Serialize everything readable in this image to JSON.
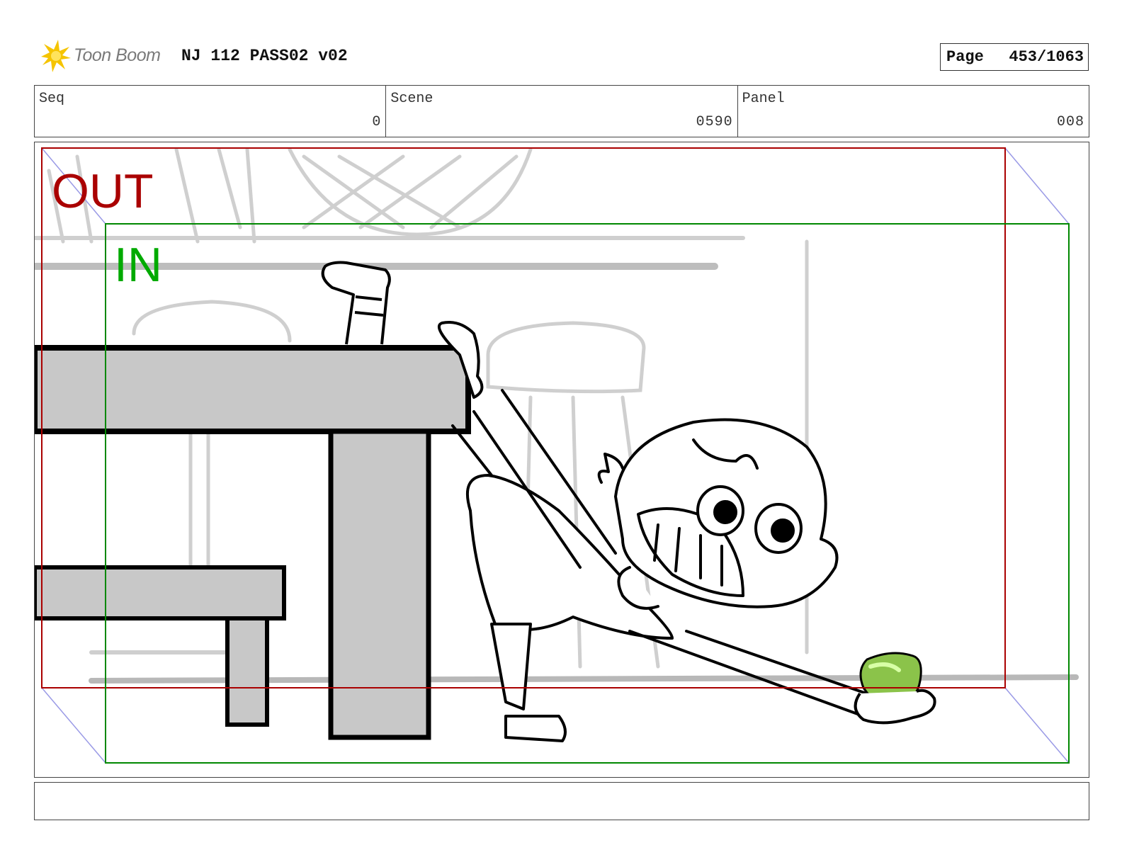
{
  "header": {
    "logo_text": "Toon Boom",
    "title": "NJ 112 PASS02 v02",
    "page_label": "Page",
    "page_value": "453/1063"
  },
  "info": {
    "seq_label": "Seq",
    "seq_value": "0",
    "scene_label": "Scene",
    "scene_value": "0590",
    "panel_label": "Panel",
    "panel_value": "008"
  },
  "frame": {
    "out_label": "OUT",
    "in_label": "IN",
    "out_color": "#aa0000",
    "in_color": "#008800"
  },
  "colors": {
    "table_gray": "#c8c8c8",
    "apple_green": "#8bc34a",
    "logo_yellow": "#f5c400"
  },
  "notes": {
    "text": ""
  }
}
